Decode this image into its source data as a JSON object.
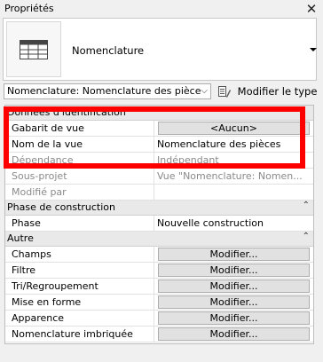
{
  "palette": {
    "title": "Propriétés",
    "close_symbol": "✕"
  },
  "type_selector": {
    "icon": "schedule-table-icon",
    "name": "Nomenclature"
  },
  "instance_selector": {
    "value": "Nomenclature: Nomenclature des pièce",
    "chevron": "⌵"
  },
  "edit_type": {
    "icon": "edit-type-icon",
    "label": "Modifier le type"
  },
  "groups": [
    {
      "label": "Données d'identification",
      "collapse": "⌃"
    },
    {
      "label": "Phase de construction",
      "collapse": "⌃"
    },
    {
      "label": "Autre",
      "collapse": "⌃"
    }
  ],
  "identification": [
    {
      "key": "Gabarit de vue",
      "value": "<Aucun>",
      "button": true
    },
    {
      "key": "Nom de la vue",
      "value": "Nomenclature des pièces"
    },
    {
      "key": "Dépendance",
      "value": "Indépendant"
    },
    {
      "key": "Sous-projet",
      "value": "Vue \"Nomenclature: Nomen..."
    },
    {
      "key": "Modifié par",
      "value": ""
    }
  ],
  "phase": [
    {
      "key": "Phase",
      "value": "Nouvelle construction"
    }
  ],
  "other": [
    {
      "key": "Champs",
      "value": "Modifier..."
    },
    {
      "key": "Filtre",
      "value": "Modifier..."
    },
    {
      "key": "Tri/Regroupement",
      "value": "Modifier..."
    },
    {
      "key": "Mise en forme",
      "value": "Modifier..."
    },
    {
      "key": "Apparence",
      "value": "Modifier..."
    },
    {
      "key": "Nomenclature imbriquée",
      "value": "Modifier..."
    }
  ],
  "highlight_color": "#ff0000"
}
